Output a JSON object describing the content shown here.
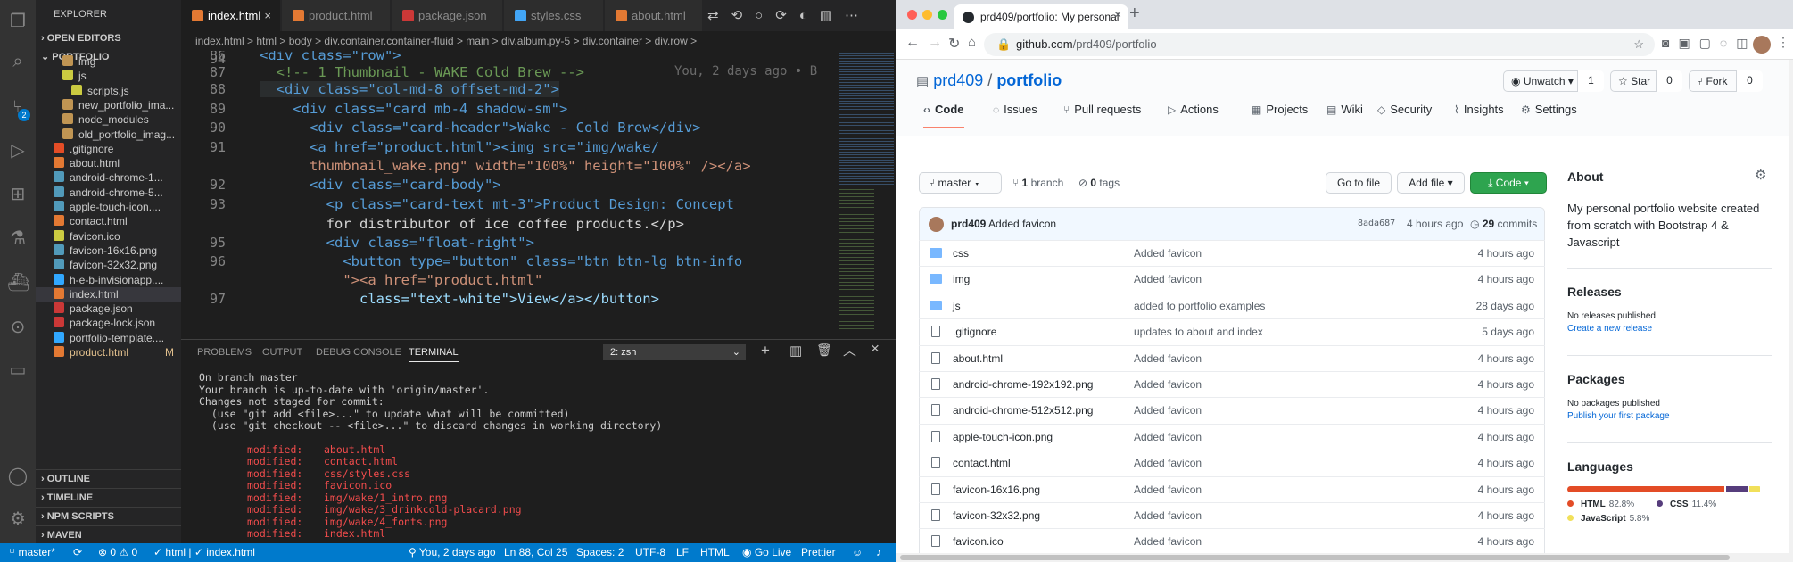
{
  "vscode": {
    "explorer_title": "EXPLORER",
    "open_editors": "OPEN EDITORS",
    "project": "PORTFOLIO",
    "tree": [
      {
        "label": "img",
        "color": "#c09553",
        "badge": ""
      },
      {
        "label": "js",
        "color": "#cbcb41",
        "badge": ""
      },
      {
        "label": "scripts.js",
        "color": "#cbcb41",
        "badge": ""
      },
      {
        "label": "new_portfolio_ima...",
        "color": "#c09553",
        "badge": ""
      },
      {
        "label": "node_modules",
        "color": "#c09553",
        "badge": ""
      },
      {
        "label": "old_portfolio_imag...",
        "color": "#c09553",
        "badge": ""
      },
      {
        "label": ".gitignore",
        "color": "#e44d26",
        "badge": ""
      },
      {
        "label": "about.html",
        "color": "#e37933",
        "badge": ""
      },
      {
        "label": "android-chrome-1...",
        "color": "#519aba",
        "badge": ""
      },
      {
        "label": "android-chrome-5...",
        "color": "#519aba",
        "badge": ""
      },
      {
        "label": "apple-touch-icon....",
        "color": "#519aba",
        "badge": ""
      },
      {
        "label": "contact.html",
        "color": "#e37933",
        "badge": ""
      },
      {
        "label": "favicon.ico",
        "color": "#cbcb41",
        "badge": ""
      },
      {
        "label": "favicon-16x16.png",
        "color": "#519aba",
        "badge": ""
      },
      {
        "label": "favicon-32x32.png",
        "color": "#519aba",
        "badge": ""
      },
      {
        "label": "h-e-b-invisionapp....",
        "color": "#31a8ff",
        "badge": ""
      },
      {
        "label": "index.html",
        "color": "#e37933",
        "badge": ""
      },
      {
        "label": "package.json",
        "color": "#cb3837",
        "badge": ""
      },
      {
        "label": "package-lock.json",
        "color": "#cb3837",
        "badge": ""
      },
      {
        "label": "portfolio-template....",
        "color": "#31a8ff",
        "badge": ""
      },
      {
        "label": "product.html",
        "color": "#e37933",
        "badge": "M"
      }
    ],
    "outline": "OUTLINE",
    "timeline": "TIMELINE",
    "npm_scripts": "NPM SCRIPTS",
    "maven": "MAVEN",
    "scm_badge": "2",
    "tabs": [
      "index.html",
      "product.html",
      "package.json",
      "styles.css",
      "about.html"
    ],
    "breadcrumbs": "index.html > html > body > div.container.container-fluid > main > div.album.py-5 > div.container > div.row >",
    "line_numbers": [
      "86",
      "87",
      "88",
      "",
      "89",
      "90",
      "91",
      "",
      "92",
      "93",
      "",
      "94",
      "95",
      "96",
      "",
      "97"
    ],
    "lines": [
      "<div class=\"row\">",
      "  <!-- 1 Thumbnail - WAKE Cold Brew -->",
      "  <div class=\"col-md-8 offset-md-2\">",
      "",
      "    <div class=\"card mb-4 shadow-sm\">",
      "      <div class=\"card-header\">Wake - Cold Brew</div>",
      "      <a href=\"product.html\"><img src=\"img/wake/",
      "      thumbnail_wake.png\" width=\"100%\" height=\"100%\" /></a>",
      "      <div class=\"card-body\">",
      "        <p class=\"card-text mt-3\">Product Design: Concept",
      "        for distributor of ice coffee products.</p>",
      "",
      "        <div class=\"float-right\">",
      "          <button type=\"button\" class=\"btn btn-lg btn-info",
      "          \"><a href=\"product.html\"",
      "            class=\"text-white\">View</a></button>"
    ],
    "blame": "You, 2 days ago • B",
    "panel_tabs": [
      "PROBLEMS",
      "OUTPUT",
      "DEBUG CONSOLE",
      "TERMINAL"
    ],
    "terminal_select": "2: zsh",
    "terminal_lines": [
      "On branch master",
      "Your branch is up-to-date with 'origin/master'.",
      "Changes not staged for commit:",
      "  (use \"git add <file>...\" to update what will be committed)",
      "  (use \"git checkout -- <file>...\" to discard changes in working directory)"
    ],
    "modified_label": "modified:",
    "modified_files": [
      "about.html",
      "contact.html",
      "css/styles.css",
      "favicon.ico",
      "img/wake/1_intro.png",
      "img/wake/3_drinkcold-placard.png",
      "img/wake/4_fonts.png",
      "index.html"
    ],
    "status": {
      "branch": "master*",
      "errors": "0",
      "warnings": "0",
      "lang_breadcrumb": "html | ✓ index.html",
      "blame": "You, 2 days ago",
      "position": "Ln 88, Col 25",
      "spaces": "Spaces: 2",
      "encoding": "UTF-8",
      "eol": "LF",
      "language": "HTML",
      "golive": "Go Live",
      "prettier": "Prettier"
    }
  },
  "chrome": {
    "tab_title": "prd409/portfolio: My personal",
    "url_host": "github.com",
    "url_path": "/prd409/portfolio"
  },
  "github": {
    "owner": "prd409",
    "repo": "portfolio",
    "unwatch": "Unwatch",
    "watch_count": "1",
    "star": "Star",
    "star_count": "0",
    "fork": "Fork",
    "fork_count": "0",
    "nav": [
      "Code",
      "Issues",
      "Pull requests",
      "Actions",
      "Projects",
      "Wiki",
      "Security",
      "Insights",
      "Settings"
    ],
    "branch": "master",
    "branch_count": "1",
    "branch_label": "branch",
    "tag_count": "0",
    "tag_label": "tags",
    "go_to_file": "Go to file",
    "add_file": "Add file",
    "code_btn": "Code",
    "commit": {
      "author": "prd409",
      "message": "Added favicon",
      "hash": "8ada687",
      "age": "4 hours ago",
      "count": "29",
      "count_label": "commits"
    },
    "files": [
      {
        "name": "css",
        "msg": "Added favicon",
        "age": "4 hours ago",
        "folder": true
      },
      {
        "name": "img",
        "msg": "Added favicon",
        "age": "4 hours ago",
        "folder": true
      },
      {
        "name": "js",
        "msg": "added to portfolio examples",
        "age": "28 days ago",
        "folder": true
      },
      {
        "name": ".gitignore",
        "msg": "updates to about and index",
        "age": "5 days ago",
        "folder": false
      },
      {
        "name": "about.html",
        "msg": "Added favicon",
        "age": "4 hours ago",
        "folder": false
      },
      {
        "name": "android-chrome-192x192.png",
        "msg": "Added favicon",
        "age": "4 hours ago",
        "folder": false
      },
      {
        "name": "android-chrome-512x512.png",
        "msg": "Added favicon",
        "age": "4 hours ago",
        "folder": false
      },
      {
        "name": "apple-touch-icon.png",
        "msg": "Added favicon",
        "age": "4 hours ago",
        "folder": false
      },
      {
        "name": "contact.html",
        "msg": "Added favicon",
        "age": "4 hours ago",
        "folder": false
      },
      {
        "name": "favicon-16x16.png",
        "msg": "Added favicon",
        "age": "4 hours ago",
        "folder": false
      },
      {
        "name": "favicon-32x32.png",
        "msg": "Added favicon",
        "age": "4 hours ago",
        "folder": false
      },
      {
        "name": "favicon.ico",
        "msg": "Added favicon",
        "age": "4 hours ago",
        "folder": false
      }
    ],
    "about_title": "About",
    "about_text": "My personal portfolio website created from scratch with Bootstrap 4 & Javascript",
    "releases_title": "Releases",
    "releases_none": "No releases published",
    "releases_link": "Create a new release",
    "packages_title": "Packages",
    "packages_none": "No packages published",
    "packages_link": "Publish your first package",
    "languages_title": "Languages",
    "languages": [
      {
        "name": "HTML",
        "pct": "82.8%",
        "value": 82.8,
        "color": "#e34c26"
      },
      {
        "name": "CSS",
        "pct": "11.4%",
        "value": 11.4,
        "color": "#563d7c"
      },
      {
        "name": "JavaScript",
        "pct": "5.8%",
        "value": 5.8,
        "color": "#f1e05a"
      }
    ]
  }
}
